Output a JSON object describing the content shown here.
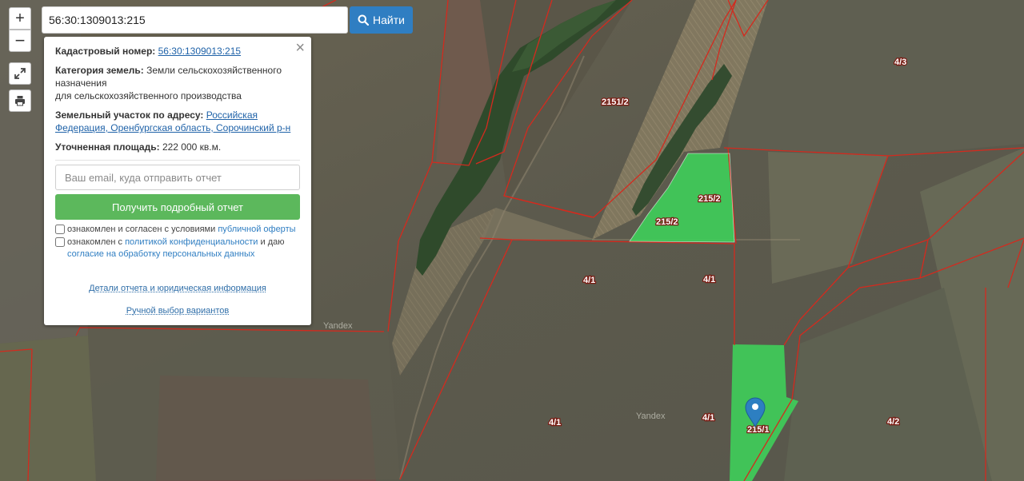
{
  "search": {
    "value": "56:30:1309013:215",
    "button_label": "Найти",
    "search_icon": "search-icon"
  },
  "controls": {
    "zoom_in": "+",
    "zoom_out": "−",
    "fullscreen_icon": "expand-icon",
    "print_icon": "print-icon"
  },
  "popup": {
    "close_glyph": "×",
    "cadastral_label": "Кадастровый номер:",
    "cadastral_value": "56:30:1309013:215",
    "category_label": "Категория земель:",
    "category_value_1": "Земли сельскохозяйственного",
    "category_value_2": "назначения",
    "category_value_3": "для сельскохозяйственного производства",
    "address_label": "Земельный участок по адресу:",
    "address_value_1": "Российская",
    "address_value_2": "Федерация, Оренбургская область, Сорочинский р-н",
    "area_label": "Уточненная площадь:",
    "area_value": "222 000 кв.м.",
    "email_placeholder": "Ваш email, куда отправить отчет",
    "report_button": "Получить подробный отчет",
    "offer_text": "ознакомлен и согласен с условиями",
    "offer_link": "публичной оферты",
    "privacy_text_1": "ознакомлен с",
    "privacy_link": "политикой конфиденциальности",
    "privacy_text_2": "и даю",
    "consent_link": "согласие на обработку персональных данных",
    "details_link": "Детали отчета и юридическая информация",
    "manual_link": "Ручной выбор вариантов"
  },
  "map": {
    "parcels": {
      "p_2151_2": "2151/2",
      "p_4_3": "4/3",
      "p_215_2a": "215/2",
      "p_215_2b": "215/2",
      "p_4_1a": "4/1",
      "p_4_1b": "4/1",
      "p_4_1c": "4/1",
      "p_4_1d": "4/1",
      "p_4_2": "4/2",
      "p_215_1": "215/1"
    },
    "watermark": "Yandex",
    "boundary_color": "#d42a1e",
    "highlight_color": "#3ed25a",
    "marker_color": "#2d7fc1",
    "marker_icon": "map-marker-icon"
  }
}
